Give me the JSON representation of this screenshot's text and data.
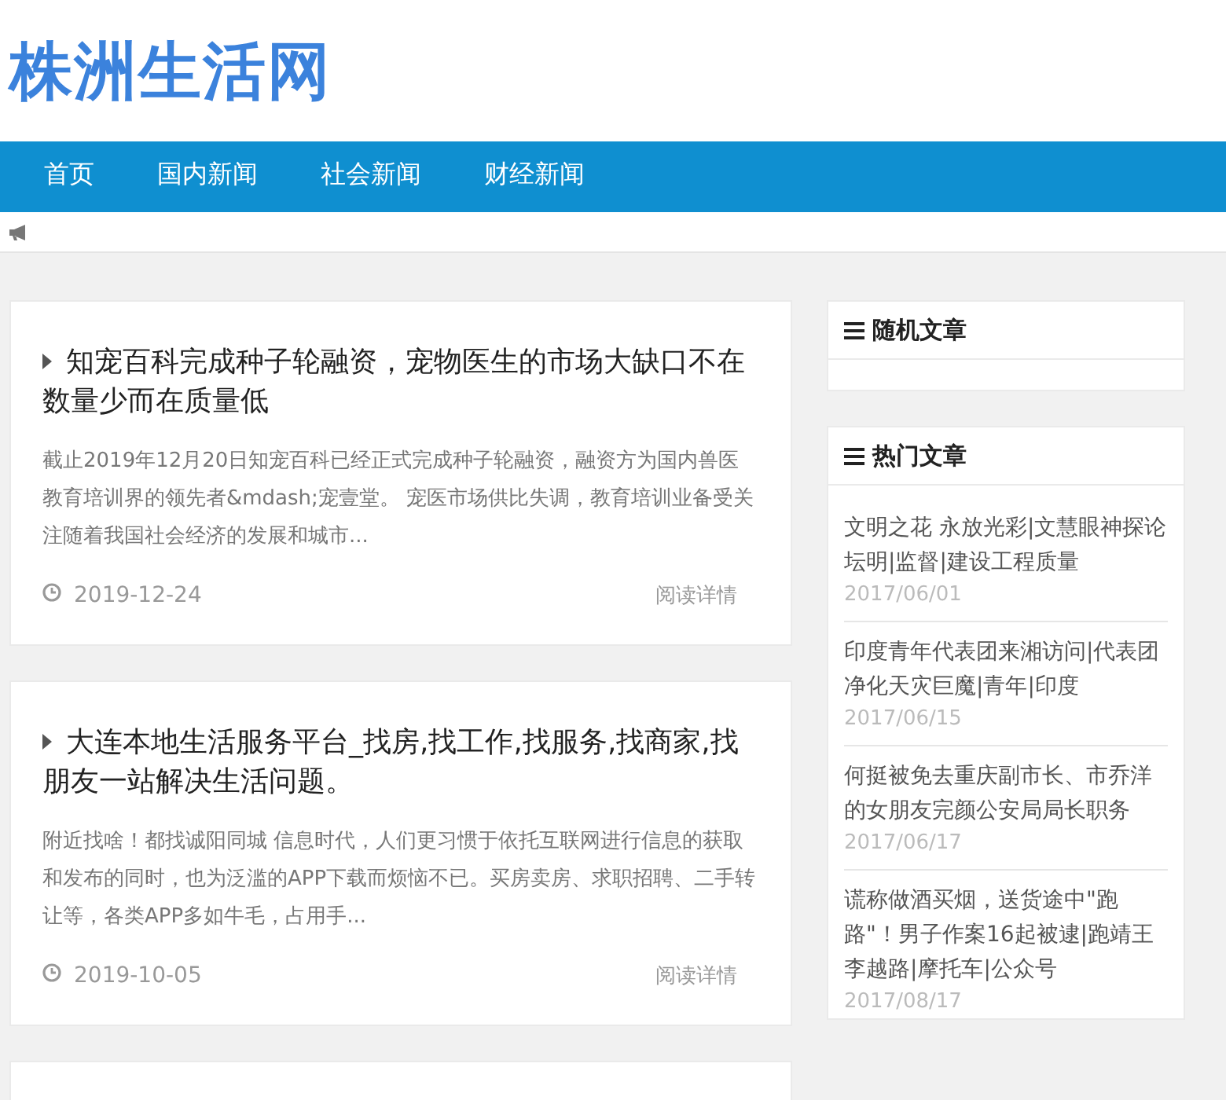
{
  "site_title": "株洲生活网",
  "nav": [
    {
      "label": "首页",
      "selected": false
    },
    {
      "label": "国内新闻",
      "selected": false
    },
    {
      "label": "社会新闻",
      "selected": false
    },
    {
      "label": "财经新闻",
      "selected": false
    }
  ],
  "articles": [
    {
      "title": "知宠百科完成种子轮融资，宠物医生的市场大缺口不在数量少而在质量低",
      "excerpt": "截止2019年12月20日知宠百科已经正式完成种子轮融资，融资方为国内兽医教育培训界的领先者&mdash;宠壹堂。 宠医市场供比失调，教育培训业备受关注随着我国社会经济的发展和城市...",
      "date": "2019-12-24",
      "more": "阅读详情"
    },
    {
      "title": "大连本地生活服务平台_找房,找工作,找服务,找商家,找朋友一站解决生活问题。",
      "excerpt": "附近找啥！都找诚阳同城 信息时代，人们更习惯于依托互联网进行信息的获取和发布的同时，也为泛滥的APP下载而烦恼不已。买房卖房、求职招聘、二手转让等，各类APP多如牛毛，占用手...",
      "date": "2019-10-05",
      "more": "阅读详情"
    }
  ],
  "sidebar": [
    {
      "title": "随机文章"
    },
    {
      "title": "热门文章",
      "items": [
        {
          "title": "文明之花 永放光彩|文慧眼神探论坛明|监督|建设工程质量",
          "date": "2017/06/01",
          "kind": "block"
        },
        {
          "title": "印度青年代表团来湘访问|代表团净化天灾巨魔|青年|印度",
          "date": "2017/06/15",
          "kind": "block"
        },
        {
          "title": "何挺被免去重庆副市长、市乔洋的女朋友完颜公安局局长职务",
          "date": "2017/06/17",
          "kind": "block"
        },
        {
          "title": "谎称做酒买烟，送货途中\"跑路\"！男子作案16起被逮|跑靖王李越路|摩托车|公众号",
          "date": "2017/08/17",
          "kind": "inline"
        }
      ]
    }
  ]
}
